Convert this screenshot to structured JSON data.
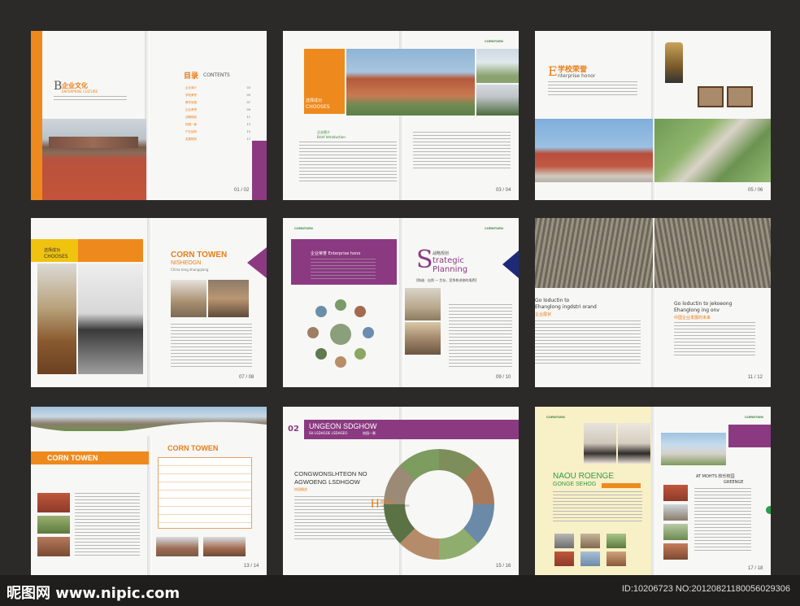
{
  "spread1": {
    "letter": "B",
    "title": "企业文化",
    "sub": "ENTERPRISE CULTURE",
    "contents_cn": "目录",
    "contents_en": "CONTENTS",
    "page": "01 / 02",
    "toc": [
      {
        "label": "企业简介",
        "num": "03"
      },
      {
        "label": "学校荣誉",
        "num": "05"
      },
      {
        "label": "教学设施",
        "num": "07"
      },
      {
        "label": "企业荣誉",
        "num": "09"
      },
      {
        "label": "战略规划",
        "num": "11"
      },
      {
        "label": "校园一景",
        "num": "13"
      },
      {
        "label": "产业结构",
        "num": "15"
      },
      {
        "label": "发展规划",
        "num": "17"
      }
    ]
  },
  "spread2": {
    "box_cn": "选择成功",
    "box_en": "CHOOSES",
    "brief_cn": "企业简介",
    "brief_en": "Brief Introduction",
    "page": "03 / 04"
  },
  "spread3": {
    "letter": "E",
    "title_cn": "学校荣誉",
    "title_en": "nterprise honor",
    "page": "05 / 06"
  },
  "spread4": {
    "box_cn": "选择成功",
    "box_en": "CHOOSES",
    "title": "CORN TOWEN",
    "sub": "NISHEOGN",
    "sub2": "China tong zhangqiang",
    "page": "07 / 08"
  },
  "spread5": {
    "banner": "企业荣誉 Enterprise hono",
    "strat_cn": "战略规划",
    "strat_en1": "trategic",
    "strat_en2": "Planning",
    "letter": "S",
    "tagline": "【和谐 · 自然 — 生存、竞争和进修的境界】",
    "page": "09 / 10"
  },
  "spread6": {
    "left_title1": "Go loductin to",
    "left_title2": "Ehanglong ingdstri orand",
    "left_cn": "企业展状",
    "right_title1": "Go loductin to jekoeong",
    "right_title2": "Ehanglong ing onv",
    "right_cn": "中国企业发展的未来",
    "page": "11 / 12"
  },
  "spread7": {
    "left_title": "CORN TOWEN",
    "right_title": "CORN TOWEN",
    "page": "13 / 14"
  },
  "spread8": {
    "num": "02",
    "title": "UNGEON SDGHOW",
    "sub": "SH LSDHGOE LSDHGEO",
    "sub_cn": "校园一景",
    "heading1": "CONGWONSLHTEON NO",
    "heading2": "AGWOENG LSDHGOW",
    "heading_cn": "校园概述",
    "h_letter": "H",
    "h_cn": "校园概况",
    "h_en": "LSDHGOE LSDHGEO",
    "page": "15 / 16"
  },
  "spread9": {
    "title1": "NAOU ROENGE",
    "title2": "GONGE SEHOG",
    "right_title1": "AT MOHTS 校乐校园",
    "right_title2": "GREENGE",
    "page": "17 / 18"
  },
  "footer": {
    "brand": "昵图网 www.nipic.com",
    "id": "ID:10206723 NO:20120821180056029306"
  },
  "logo_text": "CORNTOEN",
  "colors": {
    "orange": "#ee8a1d",
    "purple": "#8b3a82",
    "background": "#2b2a29"
  }
}
